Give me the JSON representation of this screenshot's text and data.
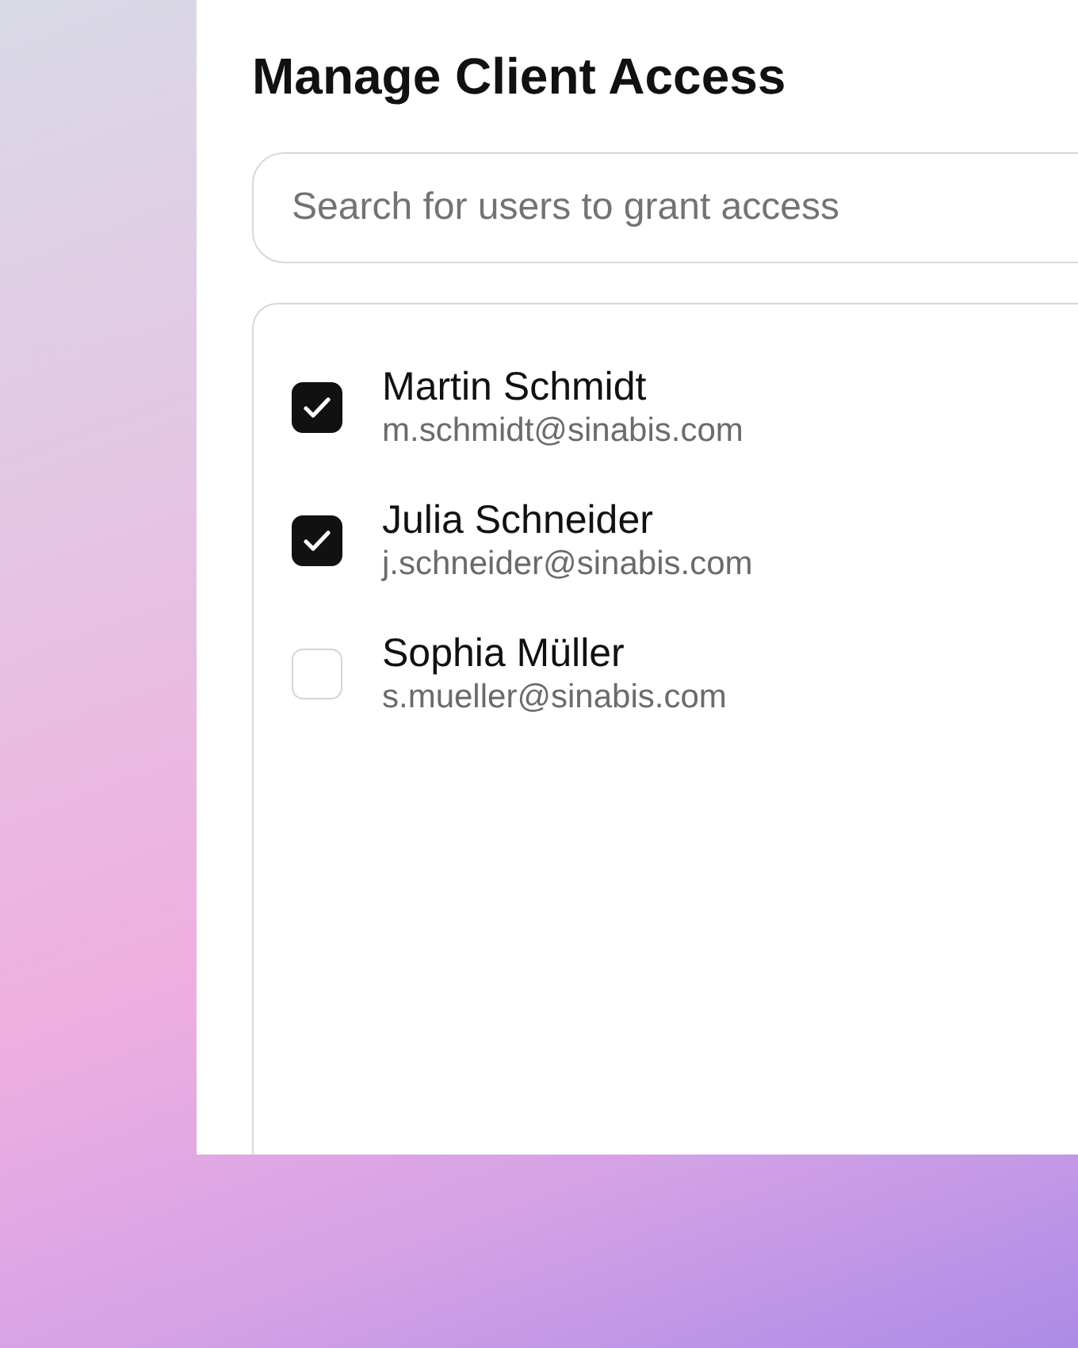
{
  "dialog": {
    "title": "Manage Client Access"
  },
  "search": {
    "placeholder": "Search for users to grant access"
  },
  "users": [
    {
      "name": "Martin Schmidt",
      "email": "m.schmidt@sinabis.com",
      "checked": true
    },
    {
      "name": "Julia Schneider",
      "email": "j.schneider@sinabis.com",
      "checked": true
    },
    {
      "name": "Sophia Müller",
      "email": "s.mueller@sinabis.com",
      "checked": false
    }
  ]
}
